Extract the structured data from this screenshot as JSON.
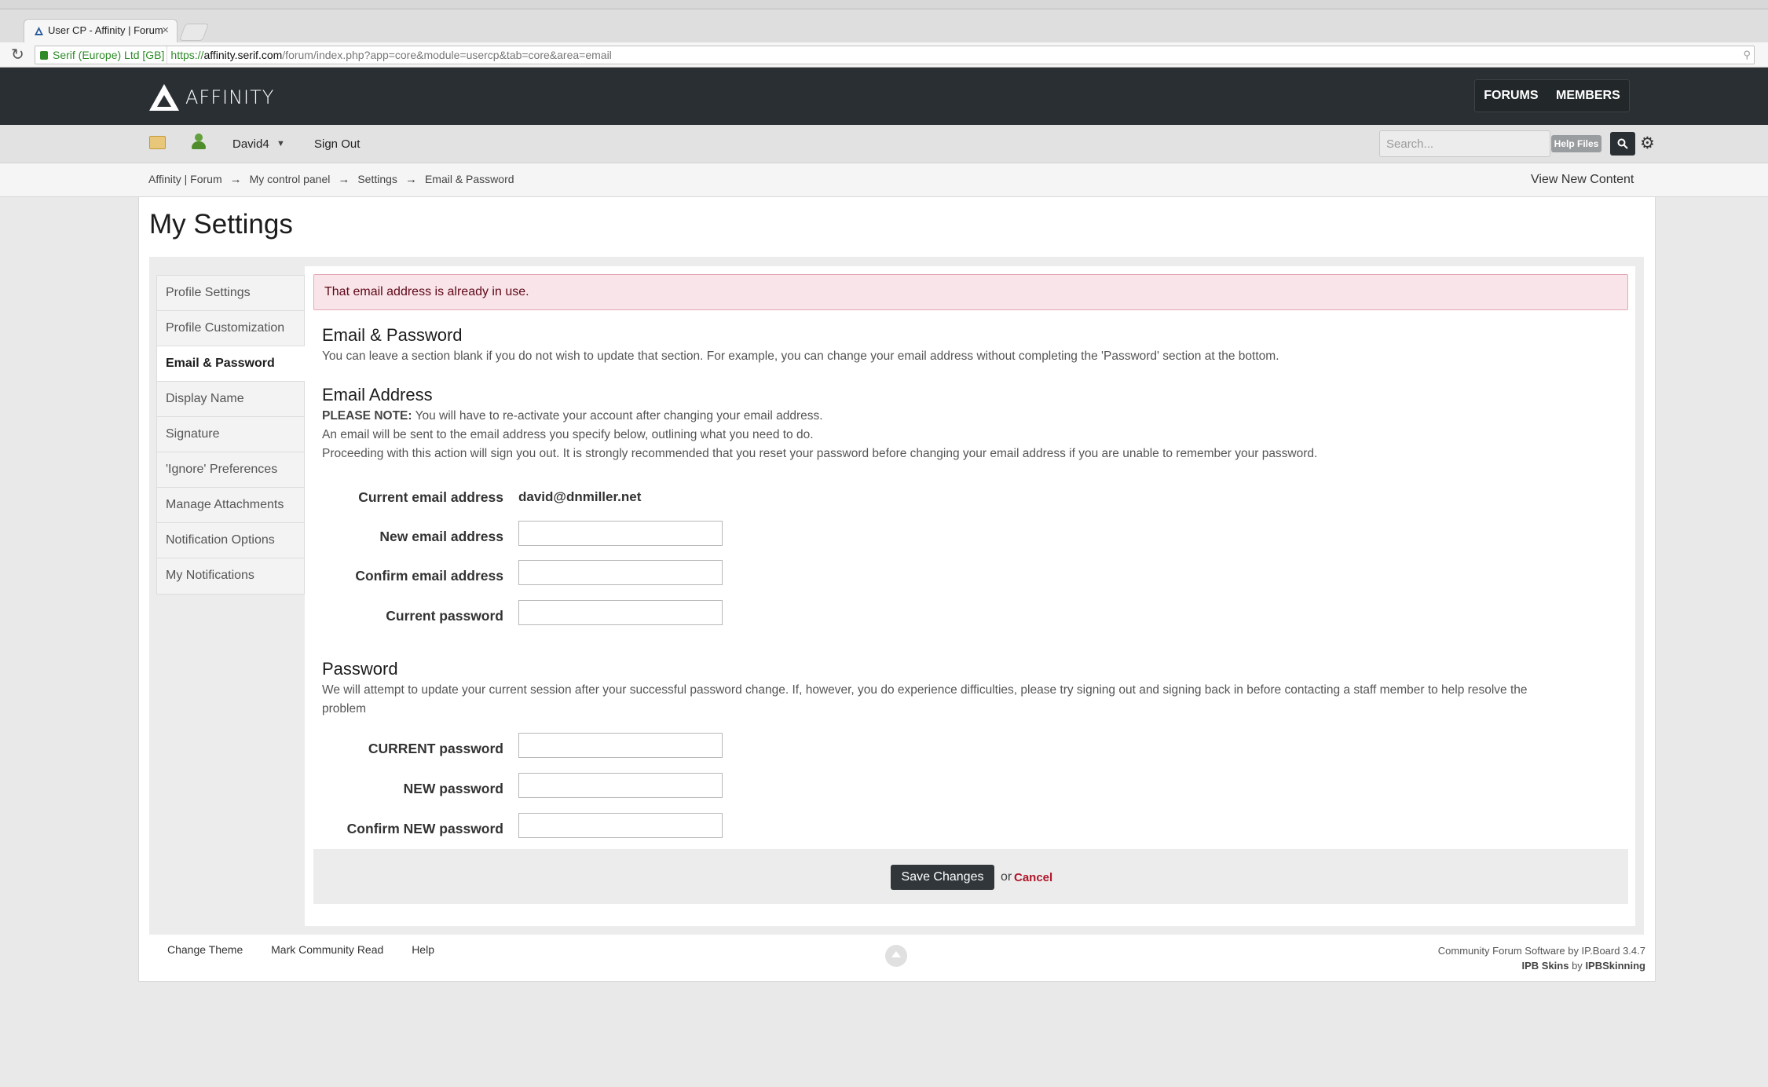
{
  "browser": {
    "tab_title": "User CP - Affinity | Forum",
    "ssl_org": "Serif (Europe) Ltd [GB]",
    "url_scheme": "https://",
    "url_host": "affinity.serif.com",
    "url_path": "/forum/index.php?app=core&module=usercp&tab=core&area=email",
    "reload_icon": "reload-icon"
  },
  "header": {
    "logo_text": "AFFINITY",
    "nav": [
      "FORUMS",
      "MEMBERS"
    ]
  },
  "user_bar": {
    "username": "David4",
    "sign_out": "Sign Out",
    "search_placeholder": "Search...",
    "help_files": "Help Files"
  },
  "breadcrumb": [
    "Affinity | Forum",
    "My control panel",
    "Settings",
    "Email & Password"
  ],
  "breadcrumb_separator": "→",
  "view_new_content": "View New Content",
  "page_title": "My Settings",
  "sidebar": {
    "items": [
      {
        "label": "Profile Settings",
        "active": false
      },
      {
        "label": "Profile Customization",
        "active": false
      },
      {
        "label": "Email & Password",
        "active": true
      },
      {
        "label": "Display Name",
        "active": false
      },
      {
        "label": "Signature",
        "active": false
      },
      {
        "label": "'Ignore' Preferences",
        "active": false
      },
      {
        "label": "Manage Attachments",
        "active": false
      },
      {
        "label": "Notification Options",
        "active": false
      },
      {
        "label": "My Notifications",
        "active": false
      }
    ]
  },
  "error_message": "That email address is already in use.",
  "email_password": {
    "heading": "Email & Password",
    "intro": "You can leave a section blank if you do not wish to update that section. For example, you can change your email address without completing the 'Password' section at the bottom."
  },
  "email_section": {
    "heading": "Email Address",
    "note_label": "PLEASE NOTE:",
    "note_text": " You will have to re-activate your account after changing your email address.",
    "line2": "An email will be sent to the email address you specify below, outlining what you need to do.",
    "line3": "Proceeding with this action will sign you out. It is strongly recommended that you reset your password before changing your email address if you are unable to remember your password.",
    "current_email_label": "Current email address",
    "current_email_value": "david@dnmiller.net",
    "new_email_label": "New email address",
    "new_email_value": "",
    "confirm_email_label": "Confirm email address",
    "confirm_email_value": "",
    "current_password_label": "Current password",
    "current_password_value": ""
  },
  "password_section": {
    "heading": "Password",
    "line1": "We will attempt to update your current session after your successful password change. If, however, you do experience difficulties, please try signing out and signing back in before contacting a staff member to help resolve the",
    "line2": "problem",
    "current_label": "CURRENT password",
    "new_label": "NEW password",
    "confirm_label": "Confirm NEW password"
  },
  "actions": {
    "save": "Save Changes",
    "or": "or",
    "cancel": "Cancel"
  },
  "footer": {
    "links": [
      "Change Theme",
      "Mark Community Read",
      "Help"
    ],
    "copyright_line1": "Community Forum Software by IP.Board 3.4.7",
    "skins_label": "IPB Skins",
    "skins_by": " by ",
    "skins_author": "IPBSkinning"
  },
  "colors": {
    "header_bg": "#2a2f33",
    "error_bg": "#f8e4e9",
    "error_text": "#5f0716",
    "cancel": "#b0152a",
    "ssl_green": "#2e8b28"
  }
}
